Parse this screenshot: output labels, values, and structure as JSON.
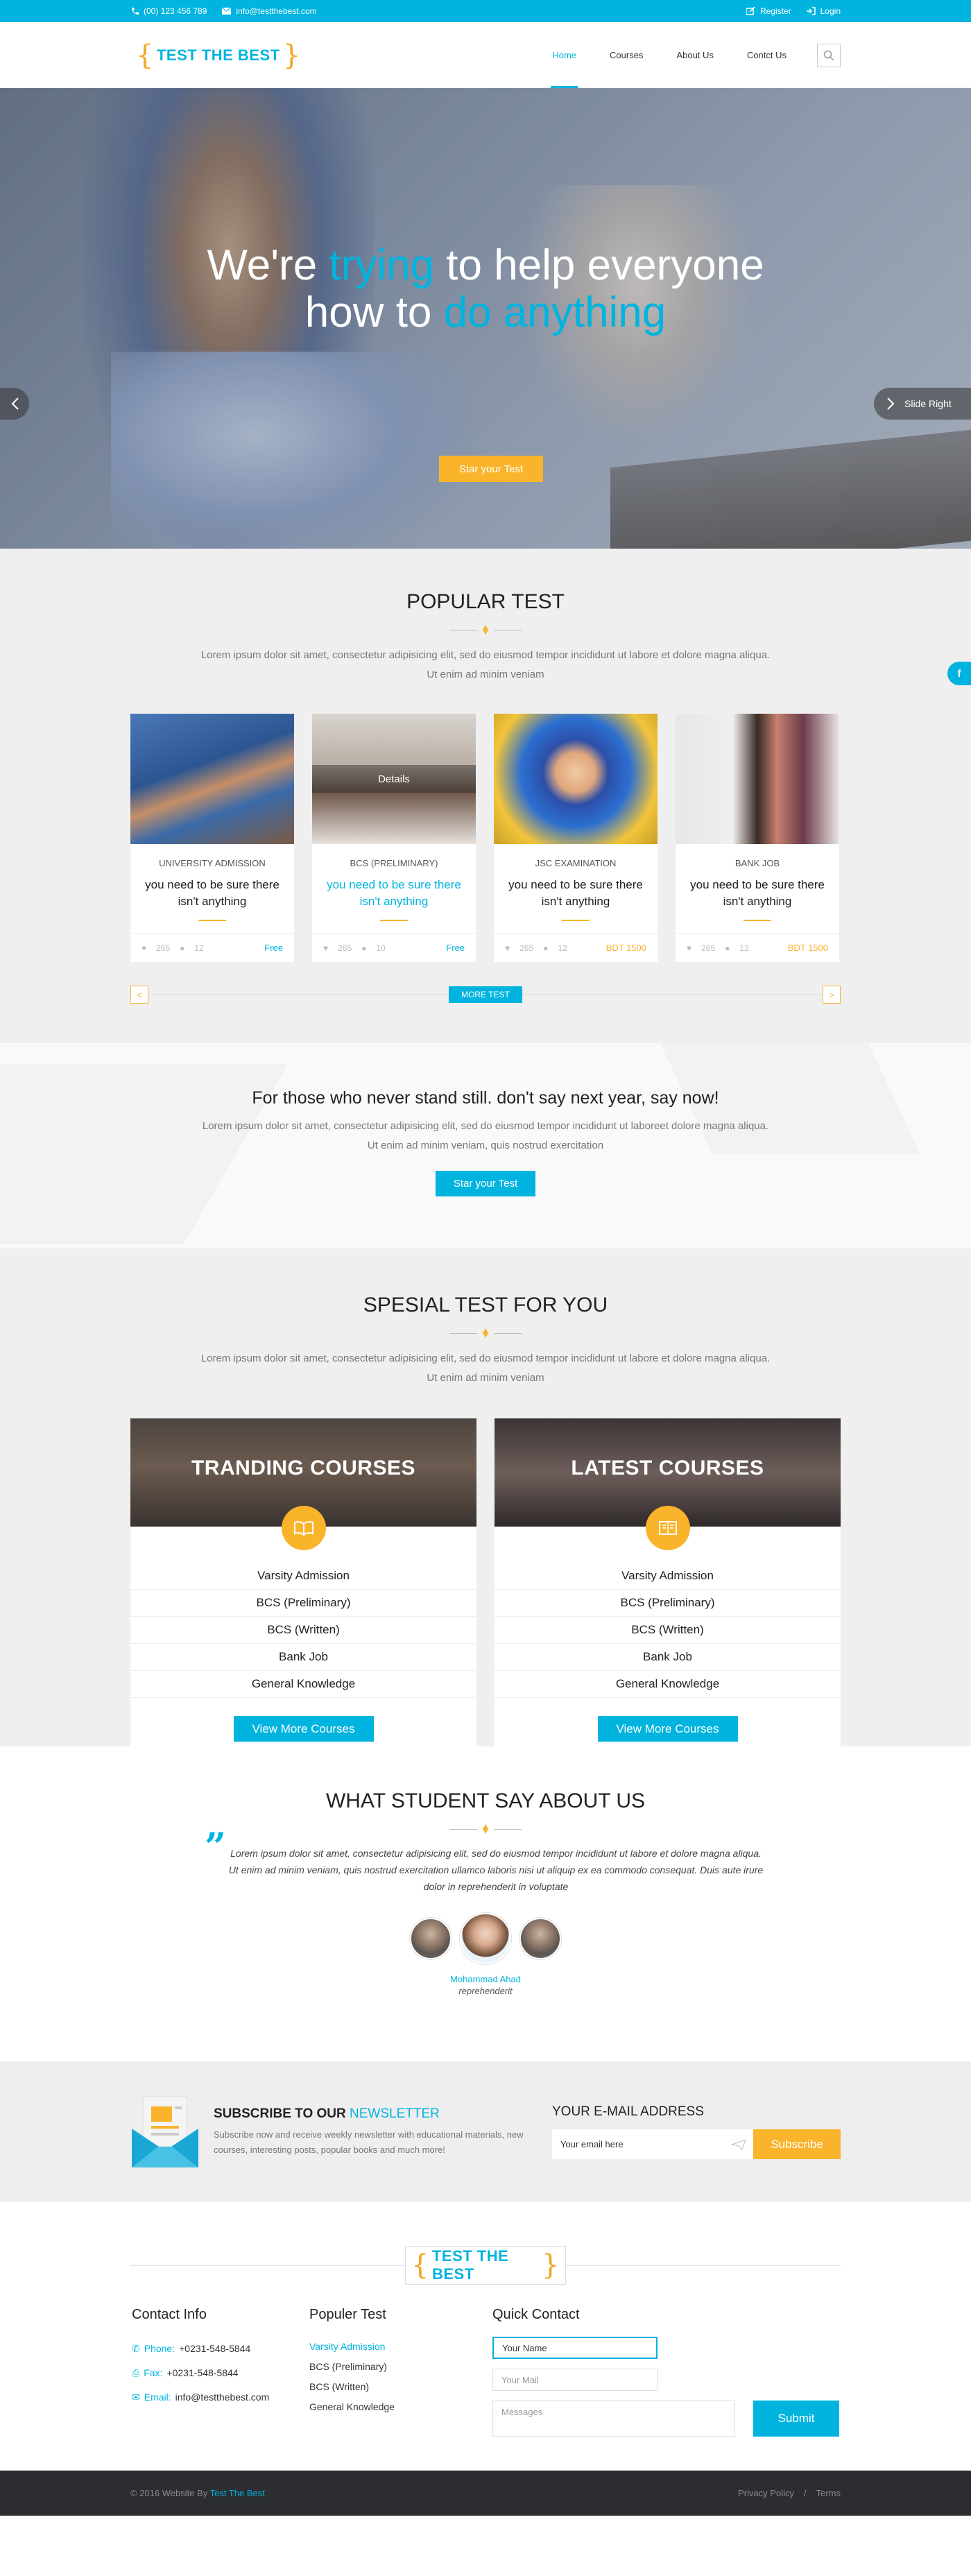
{
  "topbar": {
    "phone": "(00) 123 456 789",
    "email": "info@testthebest.com",
    "register": "Register",
    "login": "Login"
  },
  "brand": {
    "name": "TEST THE BEST",
    "open": "{",
    "close": "}"
  },
  "nav": {
    "items": [
      "Home",
      "Courses",
      "About Us",
      "Contct Us"
    ],
    "active": "Home"
  },
  "hero": {
    "line1_a": "We're ",
    "line1_b": "trying",
    "line1_c": " to help everyone",
    "line2_a": "how to ",
    "line2_b": "do anything",
    "cta": "Star your Test",
    "slide_right": "Slide Right"
  },
  "popular": {
    "title": "POPULAR TEST",
    "lead": "Lorem ipsum dolor sit amet, consectetur adipisicing elit, sed do eiusmod tempor incididunt ut labore et dolore magna aliqua. Ut enim ad minim veniam",
    "detail_label": "Details",
    "cards": [
      {
        "category": "UNIVERSITY ADMISSION",
        "title": "you need to be sure there isn't anything",
        "likes": "265",
        "comments": "12",
        "price": "Free"
      },
      {
        "category": "BCS (PRELIMINARY)",
        "title": "you need to be sure there isn't anything",
        "likes": "265",
        "comments": "10",
        "price": "Free"
      },
      {
        "category": "JSC EXAMINATION",
        "title": "you need to be sure there isn't anything",
        "likes": "265",
        "comments": "12",
        "price": "BDT 1500"
      },
      {
        "category": "BANK JOB",
        "title": "you need to be sure there isn't anything",
        "likes": "265",
        "comments": "12",
        "price": "BDT 1500"
      }
    ],
    "more": "MORE TEST",
    "prev": "<",
    "next": ">",
    "facebook": "f"
  },
  "stand": {
    "title": "For those who never stand still. don't say next year, say now!",
    "lead": "Lorem ipsum dolor sit amet, consectetur adipisicing elit, sed do eiusmod tempor incididunt ut laboreet dolore magna aliqua. Ut enim ad minim veniam, quis nostrud exercitation",
    "cta": "Star your Test"
  },
  "special": {
    "title": "SPESIAL TEST FOR YOU",
    "lead": "Lorem ipsum dolor sit amet, consectetur adipisicing elit, sed do eiusmod tempor incididunt ut labore et dolore magna aliqua. Ut enim ad minim veniam",
    "courses": [
      {
        "title": "TRANDING COURSES",
        "items": [
          "Varsity Admission",
          "BCS (Preliminary)",
          "BCS (Written)",
          "Bank Job",
          "General Knowledge"
        ],
        "button": "View More Courses"
      },
      {
        "title": "LATEST COURSES",
        "items": [
          "Varsity Admission",
          "BCS (Preliminary)",
          "BCS (Written)",
          "Bank Job",
          "General Knowledge"
        ],
        "button": "View More Courses"
      }
    ]
  },
  "testimonials": {
    "title": "WHAT STUDENT SAY ABOUT US",
    "quote": "Lorem ipsum dolor sit amet, consectetur adipisicing elit, sed do eiusmod tempor incididunt ut labore et dolore magna aliqua. Ut enim ad minim veniam, quis nostrud exercitation ullamco laboris nisi ut aliquip ex ea commodo consequat. Duis aute irure dolor in reprehenderit in voluptate",
    "quote_mark": "”",
    "name": "Mohammad Ahad",
    "role": "reprehenderit"
  },
  "newsletter": {
    "title_a": "SUBSCRIBE TO OUR ",
    "title_b": "NEWSLETTER",
    "desc": "Subscribe now and receive weekly newsletter with educational materials, new courses, interesting posts, popular books and much more!",
    "label": "YOUR E-MAIL ADDRESS",
    "placeholder": "Your email here",
    "button": "Subscribe"
  },
  "footer": {
    "contact": {
      "title": "Contact Info",
      "phone_label": "Phone:",
      "phone": "+0231-548-5844",
      "fax_label": "Fax:",
      "fax": "+0231-548-5844",
      "email_label": "Email:",
      "email": "info@testthebest.com"
    },
    "populer": {
      "title": "Populer Test",
      "links": [
        "Varsity Admission",
        "BCS (Preliminary)",
        "BCS (Written)",
        "General Knowledge"
      ]
    },
    "quick": {
      "title": "Quick Contact",
      "name": "Your Name",
      "mail": "Your Mail",
      "messages": "Messages",
      "submit": "Submit"
    }
  },
  "bottom": {
    "copy": "© 2016 Website By ",
    "brand": "Test The Best",
    "privacy": "Privacy Policy",
    "sep": "/",
    "terms": "Terms"
  },
  "colors": {
    "accent": "#00b4df",
    "orange": "#f9b42c"
  }
}
